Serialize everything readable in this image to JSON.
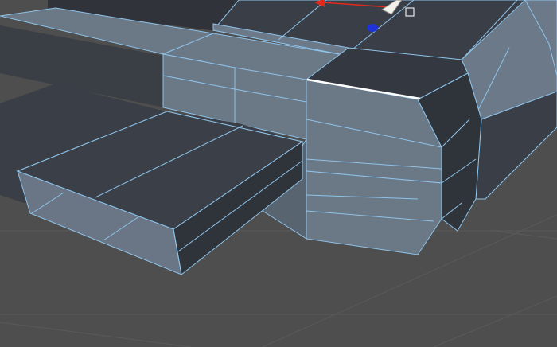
{
  "viewport": {
    "view": "perspective",
    "colors": {
      "background": "#4e4e4e",
      "grid_line": "#5c5c5c",
      "mesh_face_light": "#6b7886",
      "mesh_face_dark": "#383c44",
      "wire": "#8ec3ea",
      "selected_edge": "#ffffff",
      "gizmo_x": "#e3281c",
      "gizmo_z": "#1f33d8"
    }
  },
  "selection": {
    "mode": "edge",
    "selected_edges": 1
  },
  "gizmo": {
    "axes": [
      "x-axis-handle",
      "z-axis-handle"
    ],
    "icon": "move-gizmo-icon"
  }
}
